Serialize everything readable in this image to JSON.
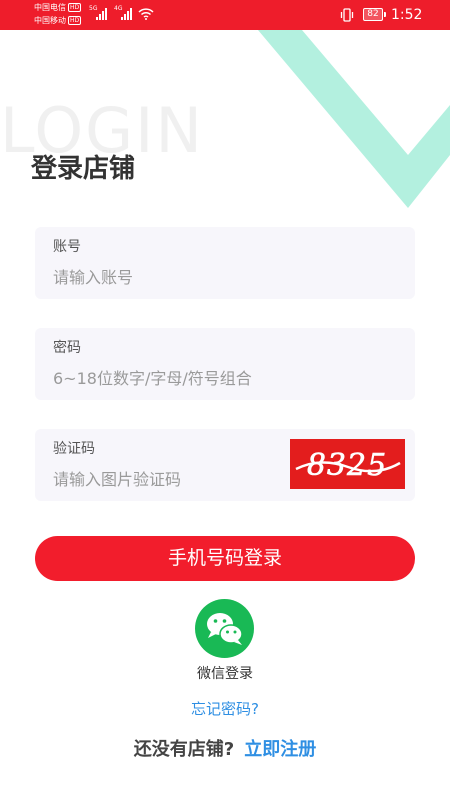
{
  "status_bar": {
    "carrier1": "中国电信",
    "carrier2": "中国移动",
    "hd_badge": "HD",
    "net1": "5G",
    "net2": "4G",
    "battery": "82",
    "time": "1:52"
  },
  "colors": {
    "brand_red": "#f21d2c",
    "accent_teal": "#b3f0df",
    "link_blue": "#2f8fe3",
    "wechat_green": "#19b955"
  },
  "background_word": "LOGIN",
  "page_title": "登录店铺",
  "form": {
    "account": {
      "label": "账号",
      "placeholder": "请输入账号"
    },
    "password": {
      "label": "密码",
      "placeholder": "6~18位数字/字母/符号组合"
    },
    "captcha": {
      "label": "验证码",
      "placeholder": "请输入图片验证码",
      "image_text": "8325"
    }
  },
  "login_button": "手机号码登录",
  "wechat_login": {
    "icon": "wechat-icon",
    "label": "微信登录"
  },
  "forgot_password": "忘记密码?",
  "register": {
    "question": "还没有店铺?",
    "link": "立即注册"
  }
}
